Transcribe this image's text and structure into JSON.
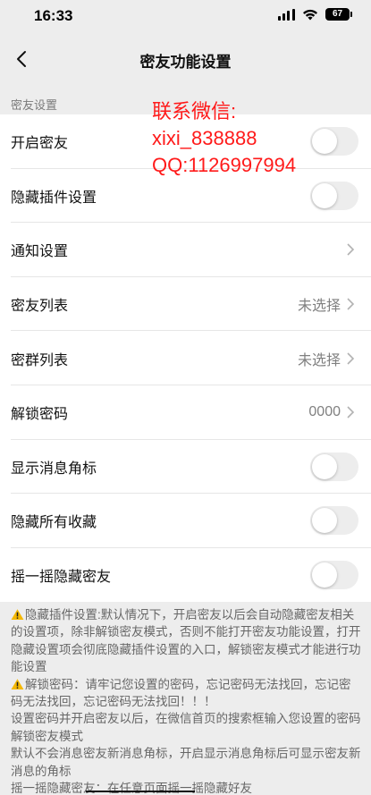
{
  "status_bar": {
    "time": "16:33",
    "battery": "67"
  },
  "nav": {
    "title": "密友功能设置"
  },
  "section": {
    "label": "密友设置"
  },
  "rows": [
    {
      "label": "开启密友"
    },
    {
      "label": "隐藏插件设置"
    },
    {
      "label": "通知设置"
    },
    {
      "label": "密友列表",
      "value": "未选择"
    },
    {
      "label": "密群列表",
      "value": "未选择"
    },
    {
      "label": "解锁密码",
      "value": "0000"
    },
    {
      "label": "显示消息角标"
    },
    {
      "label": "隐藏所有收藏"
    },
    {
      "label": "摇一摇隐藏密友"
    }
  ],
  "watermark": {
    "line1": "联系微信:",
    "line2": "xixi_838888",
    "line3": "QQ:1126997994"
  },
  "notes": {
    "p1": "隐藏插件设置:默认情况下，开启密友以后会自动隐藏密友相关的设置项，除非解锁密友模式，否则不能打开密友功能设置，打开隐藏设置项会彻底隐藏插件设置的入口，解锁密友模式才能进行功能设置",
    "p2": "解锁密码：请牢记您设置的密码，忘记密码无法找回，忘记密码无法找回，忘记密码无法找回！！！",
    "p3": "设置密码并开启密友以后，在微信首页的搜索框输入您设置的密码解锁密友模式",
    "p4": "默认不会消息密友新消息角标，开启显示消息角标后可显示密友新消息的角标",
    "p5": "摇一摇隐藏密友：在任意页面摇一摇隐藏好友"
  },
  "colors": {
    "background": "#ededed",
    "watermark": "#ff1a1a",
    "warning": "#f5b800"
  }
}
